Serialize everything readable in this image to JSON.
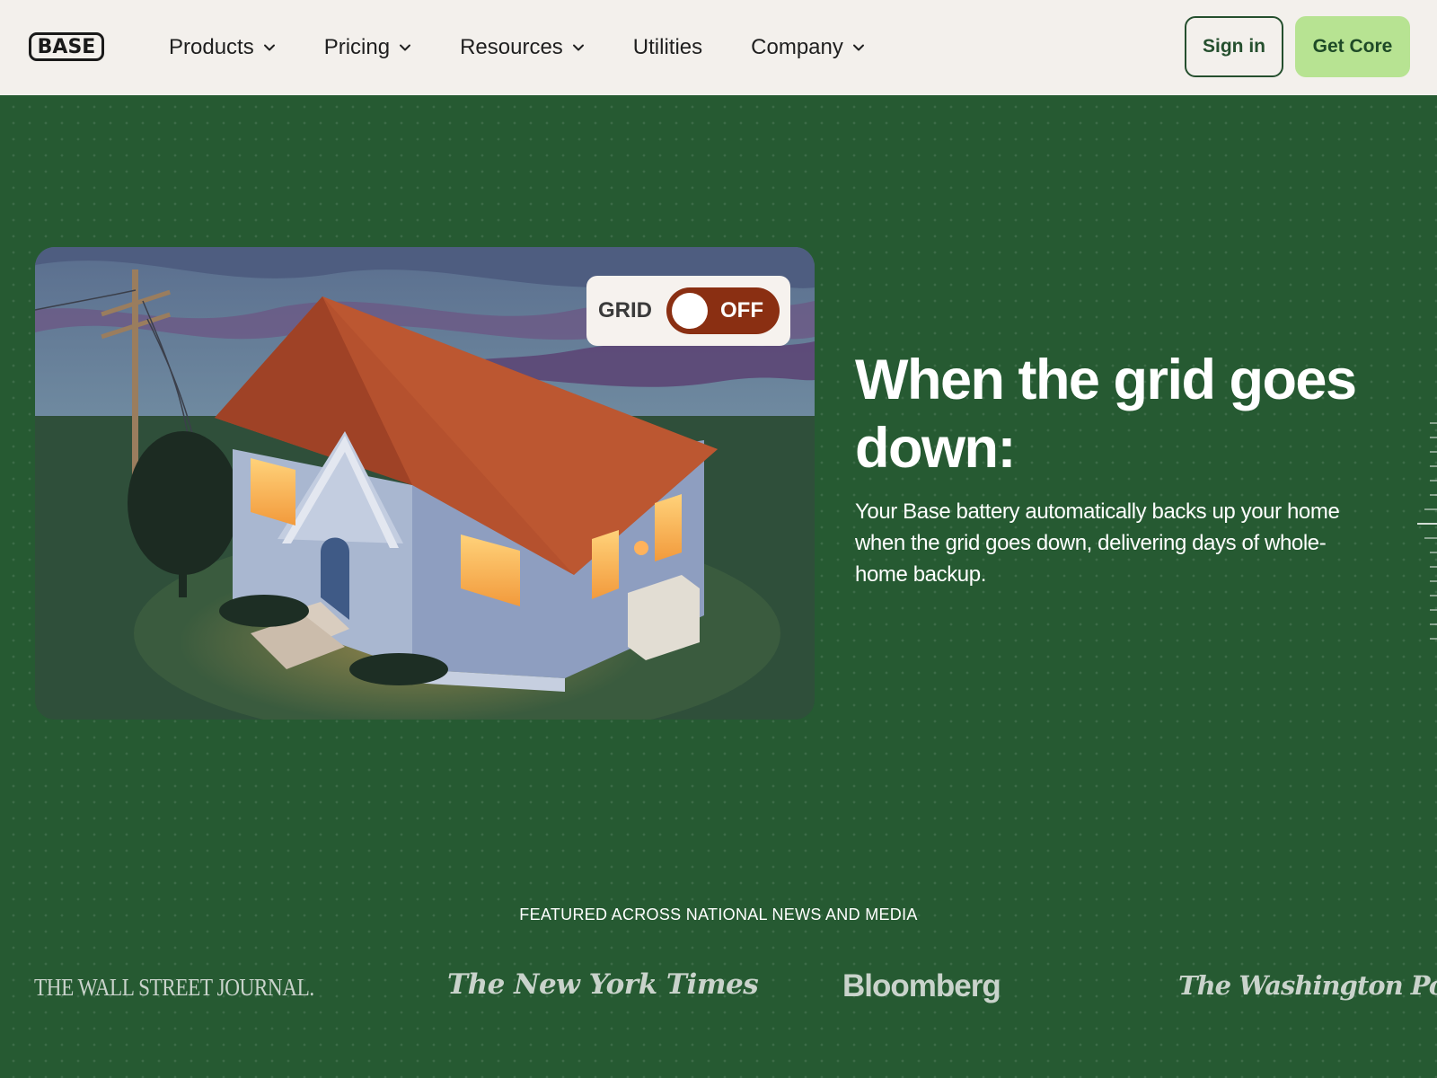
{
  "nav": {
    "logo": "BASE",
    "items": [
      {
        "label": "Products",
        "has_dropdown": true
      },
      {
        "label": "Pricing",
        "has_dropdown": true
      },
      {
        "label": "Resources",
        "has_dropdown": true
      },
      {
        "label": "Utilities",
        "has_dropdown": false
      },
      {
        "label": "Company",
        "has_dropdown": true
      }
    ],
    "signin_label": "Sign in",
    "cta_label": "Get Core"
  },
  "hero": {
    "toggle": {
      "label": "GRID",
      "state": "OFF"
    },
    "headline": "When the grid goes down:",
    "body": "Your Base battery automatically backs up your home when the grid goes down, delivering days of whole-home backup.",
    "illustration": "house-at-night-illustration"
  },
  "featured": {
    "heading": "FEATURED ACROSS NATIONAL NEWS AND MEDIA",
    "outlets": [
      "THE WALL STREET JOURNAL.",
      "The New York Times",
      "Bloomberg",
      "The Washington Post"
    ]
  },
  "colors": {
    "background": "#265a32",
    "nav_bg": "#f3f0ec",
    "cta_bg": "#b7e392",
    "toggle_bg": "#8a2f12"
  }
}
